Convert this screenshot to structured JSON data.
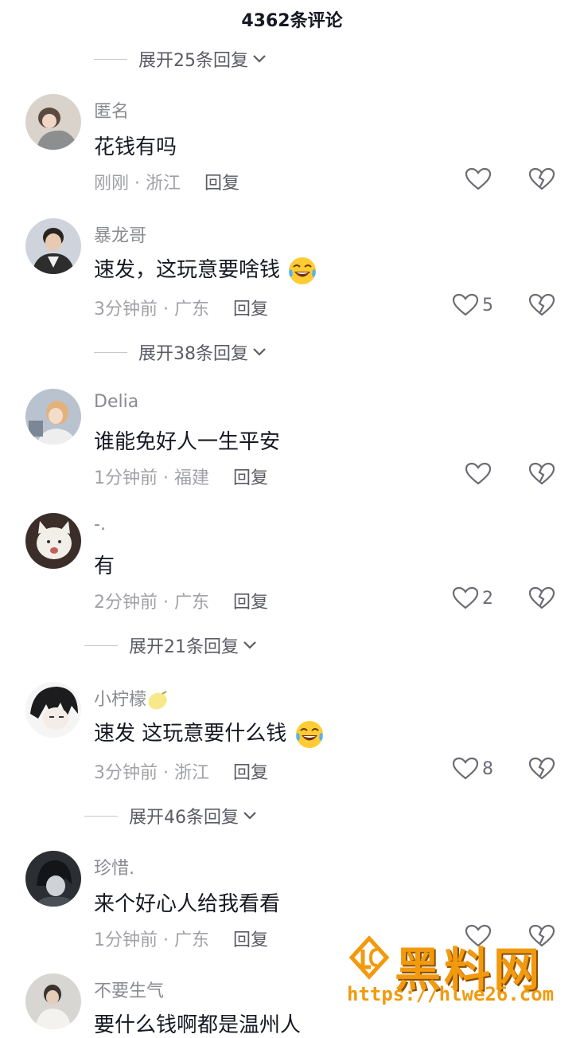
{
  "header": {
    "title": "4362条评论"
  },
  "expanders": [
    "展开25条回复",
    "展开38条回复",
    "展开21条回复",
    "展开46条回复"
  ],
  "reply_label": "回复",
  "comments": [
    {
      "name": "匿名",
      "text": "花钱有吗",
      "time": "刚刚",
      "region": "浙江",
      "likes": ""
    },
    {
      "name": "暴龙哥",
      "text": "速发，这玩意要啥钱",
      "time": "3分钟前",
      "region": "广东",
      "likes": "5",
      "emoji": "tears-of-joy"
    },
    {
      "name": "Delia",
      "text": "谁能免好人一生平安",
      "time": "1分钟前",
      "region": "福建",
      "likes": ""
    },
    {
      "name": "-.",
      "text": "有",
      "time": "2分钟前",
      "region": "广东",
      "likes": "2"
    },
    {
      "name": "小柠檬",
      "text": "速发 这玩意要什么钱",
      "time": "3分钟前",
      "region": "浙江",
      "likes": "8",
      "emoji": "tears-of-joy",
      "name_emoji": "lemon"
    },
    {
      "name": "珍惜.",
      "text": "来个好心人给我看看",
      "time": "1分钟前",
      "region": "广东",
      "likes": ""
    },
    {
      "name": "不要生气",
      "text": "要什么钱啊都是温州人",
      "time": "",
      "region": "",
      "likes": ""
    }
  ],
  "watermark": {
    "title": "黑料网",
    "url": "https://hlwe26.com"
  },
  "icons": {
    "like": "heart-outline-icon",
    "dislike": "broken-heart-icon",
    "expand": "chevron-down-icon"
  }
}
